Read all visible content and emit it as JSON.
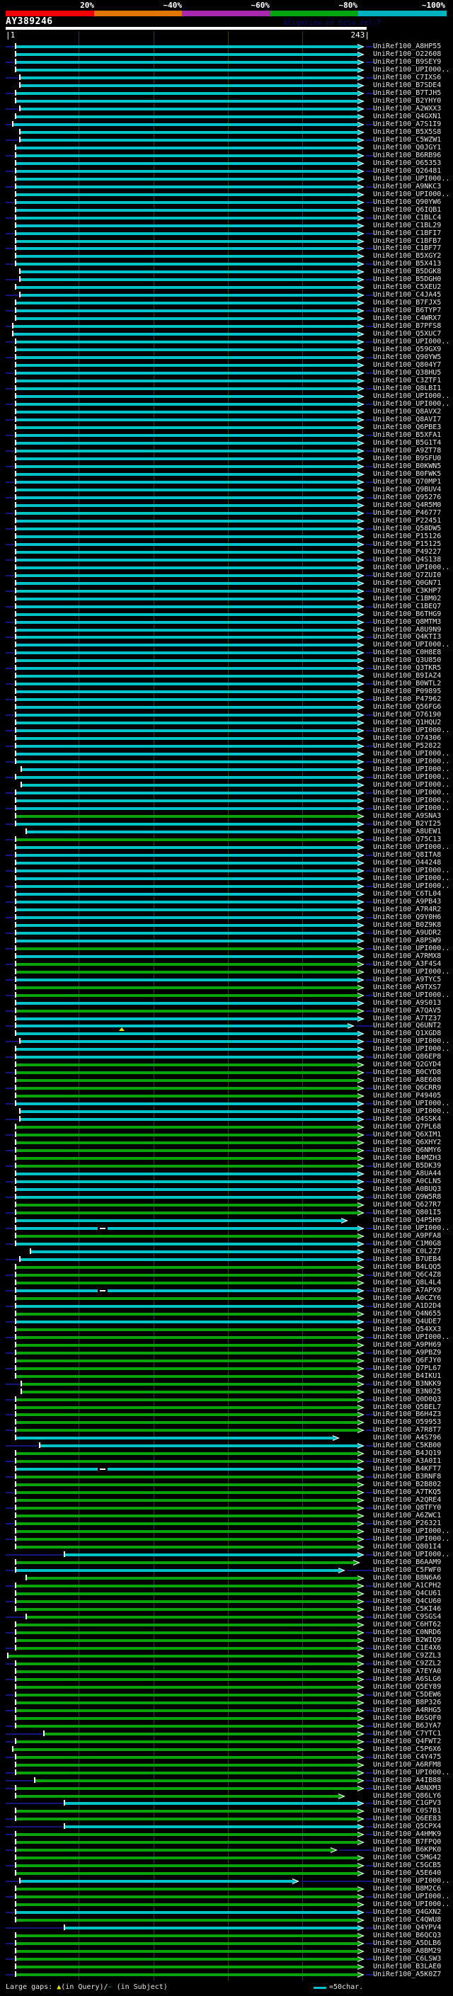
{
  "header": {
    "scale_labels": [
      "20%",
      "~40%",
      "~60%",
      "~80%",
      "~100%"
    ],
    "query_id": "AY389246",
    "watermark": "AlignView.pm Beta rel.7"
  },
  "ruler": {
    "start_label": "|1",
    "end_label": "243|",
    "query_length": 243,
    "gridline_residues": [
      50,
      100,
      150,
      200
    ]
  },
  "footer": {
    "gaps_prefix": "Large gaps: ",
    "triangle_symbol": "▲",
    "query_part": "(in Query)/",
    "dash_symbol": "-",
    "subject_part": " (in Subject)",
    "scalebar_label": "=50char."
  },
  "colors": {
    "cyan_bar": "#00c3c7",
    "green_bar": "#0aa30a",
    "navy": "#15157e",
    "grid": "#3c3c08",
    "gap_triangle": "#e6e600",
    "scale_segments": [
      "#f00000",
      "#e07800",
      "#a828b0",
      "#00a410",
      "#00b4bd"
    ]
  },
  "chart_data": {
    "type": "alignment_hit_map",
    "query_id": "AY389246",
    "query_length": 243,
    "identity_bins": [
      "20%",
      "~40%",
      "~60%",
      "~80%",
      "~100%"
    ],
    "hits": [
      {
        "l": "UniRef100_A8HP55",
        "c": "c"
      },
      {
        "l": "UniRef100_O22608",
        "c": "c"
      },
      {
        "l": "UniRef100_B9SEY9",
        "c": "c"
      },
      {
        "l": "UniRef100_UPI000..",
        "c": "c"
      },
      {
        "l": "UniRef100_C7IXS6",
        "c": "c",
        "s": 11
      },
      {
        "l": "UniRef100_B7SDE4",
        "c": "c",
        "s": 11
      },
      {
        "l": "UniRef100_B7TJH5",
        "c": "c"
      },
      {
        "l": "UniRef100_B2YHY0",
        "c": "c"
      },
      {
        "l": "UniRef100_A2WXX3",
        "c": "c",
        "s": 11
      },
      {
        "l": "UniRef100_Q4GXN1",
        "c": "c"
      },
      {
        "l": "UniRef100_A7S1I9",
        "c": "c",
        "s": 6
      },
      {
        "l": "UniRef100_B5X5S8",
        "c": "c",
        "s": 11
      },
      {
        "l": "UniRef100_C5WZW1",
        "c": "c",
        "s": 11
      },
      {
        "l": "UniRef100_Q0JGY1",
        "c": "c"
      },
      {
        "l": "UniRef100_B6RB96",
        "c": "c"
      },
      {
        "l": "UniRef100_O65353",
        "c": "c"
      },
      {
        "l": "UniRef100_Q26481",
        "c": "c"
      },
      {
        "l": "UniRef100_UPI000..",
        "c": "c"
      },
      {
        "l": "UniRef100_A9NKC3",
        "c": "c"
      },
      {
        "l": "UniRef100_UPI000..",
        "c": "c"
      },
      {
        "l": "UniRef100_Q90YW6",
        "c": "c"
      },
      {
        "l": "UniRef100_Q6IQB1",
        "c": "c"
      },
      {
        "l": "UniRef100_C1BLC4",
        "c": "c"
      },
      {
        "l": "UniRef100_C1BL29",
        "c": "c"
      },
      {
        "l": "UniRef100_C1BFI7",
        "c": "c"
      },
      {
        "l": "UniRef100_C1BFB7",
        "c": "c"
      },
      {
        "l": "UniRef100_C1BF77",
        "c": "c"
      },
      {
        "l": "UniRef100_B5XGY2",
        "c": "c"
      },
      {
        "l": "UniRef100_B5X413",
        "c": "c"
      },
      {
        "l": "UniRef100_B5DGK8",
        "c": "c",
        "s": 11
      },
      {
        "l": "UniRef100_B5DGH0",
        "c": "c",
        "s": 11
      },
      {
        "l": "UniRef100_C5XEU2",
        "c": "c"
      },
      {
        "l": "UniRef100_C4JA45",
        "c": "c",
        "s": 11
      },
      {
        "l": "UniRef100_B7FJX5",
        "c": "c"
      },
      {
        "l": "UniRef100_B6TYP7",
        "c": "c"
      },
      {
        "l": "UniRef100_C4WRX7",
        "c": "c"
      },
      {
        "l": "UniRef100_B7PFS8",
        "c": "c",
        "s": 6
      },
      {
        "l": "UniRef100_Q5XUC7",
        "c": "c",
        "s": 6
      },
      {
        "l": "UniRef100_UPI000..",
        "c": "c"
      },
      {
        "l": "UniRef100_Q59GX9",
        "c": "c"
      },
      {
        "l": "UniRef100_Q90YW5",
        "c": "c"
      },
      {
        "l": "UniRef100_Q804Y7",
        "c": "c"
      },
      {
        "l": "UniRef100_Q38HU5",
        "c": "c"
      },
      {
        "l": "UniRef100_C3ZTF1",
        "c": "c"
      },
      {
        "l": "UniRef100_Q8LBI1",
        "c": "c"
      },
      {
        "l": "UniRef100_UPI000..",
        "c": "c"
      },
      {
        "l": "UniRef100_UPI000..",
        "c": "c"
      },
      {
        "l": "UniRef100_Q8AVX2",
        "c": "c"
      },
      {
        "l": "UniRef100_Q8AVI7",
        "c": "c"
      },
      {
        "l": "UniRef100_Q6PBE3",
        "c": "c"
      },
      {
        "l": "UniRef100_B5XFA1",
        "c": "c"
      },
      {
        "l": "UniRef100_B5G1T4",
        "c": "c"
      },
      {
        "l": "UniRef100_A9ZT78",
        "c": "c"
      },
      {
        "l": "UniRef100_B9SFU0",
        "c": "c"
      },
      {
        "l": "UniRef100_B0KWN5",
        "c": "c"
      },
      {
        "l": "UniRef100_B0FWK5",
        "c": "c"
      },
      {
        "l": "UniRef100_Q70MP1",
        "c": "c"
      },
      {
        "l": "UniRef100_Q9BUV4",
        "c": "c"
      },
      {
        "l": "UniRef100_Q95276",
        "c": "c"
      },
      {
        "l": "UniRef100_Q4R5M0",
        "c": "c"
      },
      {
        "l": "UniRef100_P46777",
        "c": "c"
      },
      {
        "l": "UniRef100_P22451",
        "c": "c"
      },
      {
        "l": "UniRef100_Q58DW5",
        "c": "c"
      },
      {
        "l": "UniRef100_P15126",
        "c": "c"
      },
      {
        "l": "UniRef100_P15125",
        "c": "c"
      },
      {
        "l": "UniRef100_P49227",
        "c": "c"
      },
      {
        "l": "UniRef100_Q4S138",
        "c": "c"
      },
      {
        "l": "UniRef100_UPI000..",
        "c": "c"
      },
      {
        "l": "UniRef100_Q7ZUI0",
        "c": "c"
      },
      {
        "l": "UniRef100_Q0GN71",
        "c": "c"
      },
      {
        "l": "UniRef100_C3KHP7",
        "c": "c"
      },
      {
        "l": "UniRef100_C1BM02",
        "c": "c"
      },
      {
        "l": "UniRef100_C1BEQ7",
        "c": "c"
      },
      {
        "l": "UniRef100_B6THG9",
        "c": "c"
      },
      {
        "l": "UniRef100_Q8MTM3",
        "c": "c"
      },
      {
        "l": "UniRef100_A8U9N9",
        "c": "c"
      },
      {
        "l": "UniRef100_Q4KTI3",
        "c": "c"
      },
      {
        "l": "UniRef100_UPI000..",
        "c": "c"
      },
      {
        "l": "UniRef100_C0H8E8",
        "c": "c"
      },
      {
        "l": "UniRef100_Q3U850",
        "c": "c"
      },
      {
        "l": "UniRef100_Q3TKR5",
        "c": "c"
      },
      {
        "l": "UniRef100_B9IAZ4",
        "c": "c"
      },
      {
        "l": "UniRef100_B0WTL2",
        "c": "c"
      },
      {
        "l": "UniRef100_P09895",
        "c": "c"
      },
      {
        "l": "UniRef100_P47962",
        "c": "c"
      },
      {
        "l": "UniRef100_Q56FG6",
        "c": "c"
      },
      {
        "l": "UniRef100_O76190",
        "c": "c"
      },
      {
        "l": "UniRef100_Q1HQU2",
        "c": "c"
      },
      {
        "l": "UniRef100_UPI000..",
        "c": "c"
      },
      {
        "l": "UniRef100_O74306",
        "c": "c"
      },
      {
        "l": "UniRef100_P52822",
        "c": "c"
      },
      {
        "l": "UniRef100_UPI000..",
        "c": "c"
      },
      {
        "l": "UniRef100_UPI000..",
        "c": "c"
      },
      {
        "l": "UniRef100_UPI000..",
        "c": "c",
        "s": 12
      },
      {
        "l": "UniRef100_UPI000..",
        "c": "c"
      },
      {
        "l": "UniRef100_UPI000..",
        "c": "c",
        "s": 12
      },
      {
        "l": "UniRef100_UPI000..",
        "c": "c"
      },
      {
        "l": "UniRef100_UPI000..",
        "c": "c"
      },
      {
        "l": "UniRef100_UPI000..",
        "c": "c"
      },
      {
        "l": "UniRef100_A9SNA3",
        "c": "g"
      },
      {
        "l": "UniRef100_B2YI25",
        "c": "c"
      },
      {
        "l": "UniRef100_A8UEW1",
        "c": "c",
        "s": 15
      },
      {
        "l": "UniRef100_Q75C13",
        "c": "g"
      },
      {
        "l": "UniRef100_UPI000..",
        "c": "c"
      },
      {
        "l": "UniRef100_Q8ITA8",
        "c": "c"
      },
      {
        "l": "UniRef100_O44248",
        "c": "c"
      },
      {
        "l": "UniRef100_UPI000..",
        "c": "c"
      },
      {
        "l": "UniRef100_UPI000..",
        "c": "c"
      },
      {
        "l": "UniRef100_UPI000..",
        "c": "c"
      },
      {
        "l": "UniRef100_C6TL04",
        "c": "c"
      },
      {
        "l": "UniRef100_A9PB43",
        "c": "c"
      },
      {
        "l": "UniRef100_A7R4R2",
        "c": "c"
      },
      {
        "l": "UniRef100_Q9Y0H6",
        "c": "c"
      },
      {
        "l": "UniRef100_B0Z9K8",
        "c": "c"
      },
      {
        "l": "UniRef100_A9UDR2",
        "c": "c"
      },
      {
        "l": "UniRef100_A8PSW9",
        "c": "c"
      },
      {
        "l": "UniRef100_UPI000..",
        "c": "g"
      },
      {
        "l": "UniRef100_A7RMX8",
        "c": "c"
      },
      {
        "l": "UniRef100_A3F4S4",
        "c": "g"
      },
      {
        "l": "UniRef100_UPI000..",
        "c": "g"
      },
      {
        "l": "UniRef100_A9TYC5",
        "c": "c"
      },
      {
        "l": "UniRef100_A9TXS7",
        "c": "g"
      },
      {
        "l": "UniRef100_UPI000..",
        "c": "g"
      },
      {
        "l": "UniRef100_A9S013",
        "c": "c"
      },
      {
        "l": "UniRef100_A7QAV5",
        "c": "g"
      },
      {
        "l": "UniRef100_A7TZ37",
        "c": "c"
      },
      {
        "l": "UniRef100_Q6UNT2",
        "c": "c",
        "e": 230,
        "t": 79
      },
      {
        "l": "UniRef100_Q1XGD8",
        "c": "c"
      },
      {
        "l": "UniRef100_UPI000..",
        "c": "c",
        "s": 11
      },
      {
        "l": "UniRef100_UPI000..",
        "c": "c"
      },
      {
        "l": "UniRef100_Q86EP8",
        "c": "c"
      },
      {
        "l": "UniRef100_Q2GYD4",
        "c": "g"
      },
      {
        "l": "UniRef100_B0CYD8",
        "c": "g"
      },
      {
        "l": "UniRef100_A8E608",
        "c": "g"
      },
      {
        "l": "UniRef100_Q6CRR9",
        "c": "g"
      },
      {
        "l": "UniRef100_P49405",
        "c": "g"
      },
      {
        "l": "UniRef100_UPI000..",
        "c": "c"
      },
      {
        "l": "UniRef100_UPI000..",
        "c": "c",
        "s": 11
      },
      {
        "l": "UniRef100_Q4SSK4",
        "c": "c",
        "s": 11
      },
      {
        "l": "UniRef100_Q7PL68",
        "c": "g"
      },
      {
        "l": "UniRef100_Q6XIM1",
        "c": "g"
      },
      {
        "l": "UniRef100_Q6XHY2",
        "c": "g"
      },
      {
        "l": "UniRef100_Q6NMY6",
        "c": "g"
      },
      {
        "l": "UniRef100_B4MZH3",
        "c": "g"
      },
      {
        "l": "UniRef100_B5DK39",
        "c": "g"
      },
      {
        "l": "UniRef100_A8UA44",
        "c": "c"
      },
      {
        "l": "UniRef100_A0CLN5",
        "c": "c"
      },
      {
        "l": "UniRef100_A0BUQ3",
        "c": "c"
      },
      {
        "l": "UniRef100_Q9W5R8",
        "c": "c"
      },
      {
        "l": "UniRef100_Q627R7",
        "c": "g"
      },
      {
        "l": "UniRef100_Q801I5",
        "c": "g"
      },
      {
        "l": "UniRef100_Q4P5H9",
        "c": "c",
        "e": 226
      },
      {
        "l": "UniRef100_UPI000..",
        "c": "c",
        "d": 64
      },
      {
        "l": "UniRef100_A9PFA8",
        "c": "g"
      },
      {
        "l": "UniRef100_C1M0G8",
        "c": "c"
      },
      {
        "l": "UniRef100_C0L2Z7",
        "c": "c",
        "s": 18
      },
      {
        "l": "UniRef100_B7UEB4",
        "c": "c",
        "s": 11
      },
      {
        "l": "UniRef100_B4LQQ5",
        "c": "g"
      },
      {
        "l": "UniRef100_Q6C4Z8",
        "c": "g"
      },
      {
        "l": "UniRef100_Q8L4L4",
        "c": "g"
      },
      {
        "l": "UniRef100_A7APX9",
        "c": "c",
        "d": 64
      },
      {
        "l": "UniRef100_A0CZY6",
        "c": "g"
      },
      {
        "l": "UniRef100_A1D2D4",
        "c": "c"
      },
      {
        "l": "UniRef100_Q4N655",
        "c": "g"
      },
      {
        "l": "UniRef100_Q4UDE7",
        "c": "c"
      },
      {
        "l": "UniRef100_Q54XX3",
        "c": "g"
      },
      {
        "l": "UniRef100_UPI000..",
        "c": "g"
      },
      {
        "l": "UniRef100_A9PH69",
        "c": "g"
      },
      {
        "l": "UniRef100_A9PBZ9",
        "c": "g"
      },
      {
        "l": "UniRef100_Q6FJY0",
        "c": "g"
      },
      {
        "l": "UniRef100_Q7PL67",
        "c": "g"
      },
      {
        "l": "UniRef100_B4IKU1",
        "c": "g"
      },
      {
        "l": "UniRef100_B3NKK9",
        "c": "g",
        "s": 12
      },
      {
        "l": "UniRef100_B3N025",
        "c": "g",
        "s": 12
      },
      {
        "l": "UniRef100_Q0D0Q3",
        "c": "g"
      },
      {
        "l": "UniRef100_Q5BEL7",
        "c": "g"
      },
      {
        "l": "UniRef100_B6H4Z3",
        "c": "g"
      },
      {
        "l": "UniRef100_O59953",
        "c": "g"
      },
      {
        "l": "UniRef100_A7R8T7",
        "c": "g"
      },
      {
        "l": "UniRef100_A4S796",
        "c": "c",
        "e": 220
      },
      {
        "l": "UniRef100_C5KB00",
        "c": "c",
        "s": 24
      },
      {
        "l": "UniRef100_B4JQ19",
        "c": "g"
      },
      {
        "l": "UniRef100_A3A0I1",
        "c": "g"
      },
      {
        "l": "UniRef100_B4KFT7",
        "c": "c",
        "d": 64
      },
      {
        "l": "UniRef100_B3RNF8",
        "c": "g"
      },
      {
        "l": "UniRef100_B2B802",
        "c": "g"
      },
      {
        "l": "UniRef100_A7TKQ5",
        "c": "g"
      },
      {
        "l": "UniRef100_A2QRE4",
        "c": "g"
      },
      {
        "l": "UniRef100_Q8TFY0",
        "c": "g"
      },
      {
        "l": "UniRef100_A6ZWC1",
        "c": "g"
      },
      {
        "l": "UniRef100_P26321",
        "c": "g"
      },
      {
        "l": "UniRef100_UPI000..",
        "c": "g"
      },
      {
        "l": "UniRef100_UPI000..",
        "c": "g"
      },
      {
        "l": "UniRef100_Q801I4",
        "c": "g"
      },
      {
        "l": "UniRef100_UPI000..",
        "c": "c",
        "s": 41,
        "nl": 1
      },
      {
        "l": "UniRef100_B6AAM9",
        "c": "g",
        "e": 234
      },
      {
        "l": "UniRef100_C5FWF0",
        "c": "c",
        "e": 224
      },
      {
        "l": "UniRef100_B8N6A6",
        "c": "g",
        "s": 15
      },
      {
        "l": "UniRef100_A1CPH2",
        "c": "g"
      },
      {
        "l": "UniRef100_Q4CU61",
        "c": "g"
      },
      {
        "l": "UniRef100_Q4CU60",
        "c": "g"
      },
      {
        "l": "UniRef100_C5KI46",
        "c": "g"
      },
      {
        "l": "UniRef100_C9SGS4",
        "c": "g",
        "s": 15
      },
      {
        "l": "UniRef100_C6HT62",
        "c": "g"
      },
      {
        "l": "UniRef100_C0NRD6",
        "c": "g"
      },
      {
        "l": "UniRef100_B2WIQ9",
        "c": "g"
      },
      {
        "l": "UniRef100_C1E4X6",
        "c": "g"
      },
      {
        "l": "UniRef100_C9ZZL3",
        "c": "g",
        "s": 3
      },
      {
        "l": "UniRef100_C9ZZL2",
        "c": "g"
      },
      {
        "l": "UniRef100_A7EYA0",
        "c": "g"
      },
      {
        "l": "UniRef100_A6SLG6",
        "c": "g"
      },
      {
        "l": "UniRef100_Q5EY89",
        "c": "g"
      },
      {
        "l": "UniRef100_C5DEW6",
        "c": "g"
      },
      {
        "l": "UniRef100_B8P326",
        "c": "g"
      },
      {
        "l": "UniRef100_A4RHG5",
        "c": "g"
      },
      {
        "l": "UniRef100_B6SQF0",
        "c": "g"
      },
      {
        "l": "UniRef100_B6JYA7",
        "c": "g"
      },
      {
        "l": "UniRef100_C7YTC1",
        "c": "g",
        "s": 27,
        "nl": 1
      },
      {
        "l": "UniRef100_Q4FWT2",
        "c": "g"
      },
      {
        "l": "UniRef100_C5P6X6",
        "c": "g",
        "s": 6
      },
      {
        "l": "UniRef100_C4Y475",
        "c": "g"
      },
      {
        "l": "UniRef100_A6RFM8",
        "c": "g"
      },
      {
        "l": "UniRef100_UPI000..",
        "c": "g"
      },
      {
        "l": "UniRef100_A4IB88",
        "c": "g",
        "s": 21,
        "nl": 1
      },
      {
        "l": "UniRef100_A8NXM3",
        "c": "g"
      },
      {
        "l": "UniRef100_Q86LY6",
        "c": "g",
        "e": 224
      },
      {
        "l": "UniRef100_C1GPV3",
        "c": "c",
        "s": 41
      },
      {
        "l": "UniRef100_C0S7B1",
        "c": "g"
      },
      {
        "l": "UniRef100_Q6EE83",
        "c": "g"
      },
      {
        "l": "UniRef100_Q5CPX4",
        "c": "c",
        "s": 41,
        "nl": 1
      },
      {
        "l": "UniRef100_A4HMK9",
        "c": "g"
      },
      {
        "l": "UniRef100_B7FPQ0",
        "c": "g"
      },
      {
        "l": "UniRef100_B6KPK0",
        "c": "g",
        "e": 219
      },
      {
        "l": "UniRef100_C5MG42",
        "c": "g"
      },
      {
        "l": "UniRef100_C5GCB5",
        "c": "g"
      },
      {
        "l": "UniRef100_A5E640",
        "c": "g"
      },
      {
        "l": "UniRef100_UPI000..",
        "c": "c",
        "s": 11,
        "e": 193
      },
      {
        "l": "UniRef100_B8M2C6",
        "c": "g"
      },
      {
        "l": "UniRef100_UPI000..",
        "c": "g"
      },
      {
        "l": "UniRef100_UPI000..",
        "c": "g"
      },
      {
        "l": "UniRef100_Q4GXN2",
        "c": "c"
      },
      {
        "l": "UniRef100_C4QWU8",
        "c": "g"
      },
      {
        "l": "UniRef100_Q4YPV4",
        "c": "c",
        "s": 41,
        "nl": 1
      },
      {
        "l": "UniRef100_B6QCQ3",
        "c": "g"
      },
      {
        "l": "UniRef100_A5DLB6",
        "c": "g"
      },
      {
        "l": "UniRef100_A8BM29",
        "c": "g"
      },
      {
        "l": "UniRef100_C6LSW3",
        "c": "g"
      },
      {
        "l": "UniRef100_B3LAE0",
        "c": "g"
      },
      {
        "l": "UniRef100_A5K0Z7",
        "c": "g"
      }
    ]
  }
}
